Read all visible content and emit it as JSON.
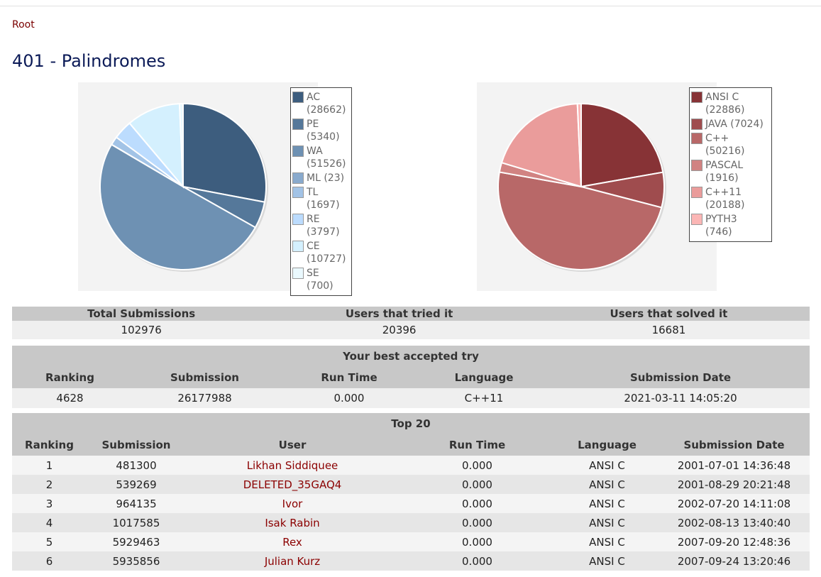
{
  "breadcrumb": "Root",
  "title": "401 - Palindromes",
  "chart_data": [
    {
      "type": "pie",
      "title": "",
      "categories": [
        "AC (28662)",
        "PE (5340)",
        "WA (51526)",
        "ML (23)",
        "TL (1697)",
        "RE (3797)",
        "CE (10727)",
        "SE (700)"
      ],
      "values": [
        28662,
        5340,
        51526,
        23,
        1697,
        3797,
        10727,
        700
      ],
      "colors": [
        "#3d5d7e",
        "#55789a",
        "#6e91b3",
        "#89aacd",
        "#a2c3e6",
        "#bcdcfe",
        "#d4f0fe",
        "#eaf9fe"
      ],
      "legend": "right"
    },
    {
      "type": "pie",
      "title": "",
      "categories": [
        "ANSI C (22886)",
        "JAVA (7024)",
        "C++ (50216)",
        "PASCAL (1916)",
        "C++11 (20188)",
        "PYTH3 (746)"
      ],
      "values": [
        22886,
        7024,
        50216,
        1916,
        20188,
        746
      ],
      "colors": [
        "#873336",
        "#9f4c4e",
        "#b86868",
        "#d18382",
        "#ea9c9b",
        "#fbb6b5"
      ],
      "legend": "right"
    }
  ],
  "stats": {
    "headers": [
      "Total Submissions",
      "Users that tried it",
      "Users that solved it"
    ],
    "values": [
      "102976",
      "20396",
      "16681"
    ]
  },
  "best": {
    "caption": "Your best accepted try",
    "headers": [
      "Ranking",
      "Submission",
      "Run Time",
      "Language",
      "Submission Date"
    ],
    "row": [
      "4628",
      "26177988",
      "0.000",
      "C++11",
      "2021-03-11 14:05:20"
    ]
  },
  "top20": {
    "caption": "Top 20",
    "headers": [
      "Ranking",
      "Submission",
      "User",
      "Run Time",
      "Language",
      "Submission Date"
    ],
    "rows": [
      [
        "1",
        "481300",
        "Likhan Siddiquee",
        "0.000",
        "ANSI C",
        "2001-07-01 14:36:48"
      ],
      [
        "2",
        "539269",
        "DELETED_35GAQ4",
        "0.000",
        "ANSI C",
        "2001-08-29 20:21:48"
      ],
      [
        "3",
        "964135",
        "Ivor",
        "0.000",
        "ANSI C",
        "2002-07-20 14:11:08"
      ],
      [
        "4",
        "1017585",
        "Isak Rabin",
        "0.000",
        "ANSI C",
        "2002-08-13 13:40:40"
      ],
      [
        "5",
        "5929463",
        "Rex",
        "0.000",
        "ANSI C",
        "2007-09-20 12:48:36"
      ],
      [
        "6",
        "5935856",
        "Julian Kurz",
        "0.000",
        "ANSI C",
        "2007-09-24 13:20:46"
      ]
    ]
  }
}
